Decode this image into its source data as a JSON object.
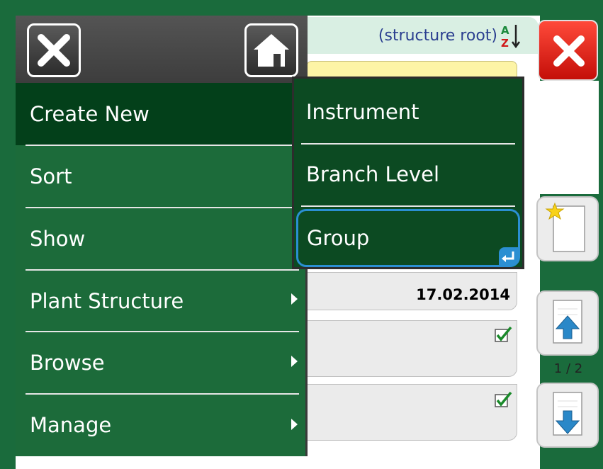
{
  "header": {
    "title": "(structure root)",
    "sort_icon": "sort-az-icon",
    "close_icon": "close-icon",
    "home_icon": "home-icon"
  },
  "menu": {
    "items": [
      {
        "label": "Create New",
        "selected": true,
        "has_submenu": false
      },
      {
        "label": "Sort",
        "has_submenu": false
      },
      {
        "label": "Show",
        "has_submenu": false
      },
      {
        "label": "Plant Structure",
        "has_submenu": true
      },
      {
        "label": "Browse",
        "has_submenu": true
      },
      {
        "label": "Manage",
        "has_submenu": true
      }
    ]
  },
  "submenu": {
    "items": [
      {
        "label": "Instrument"
      },
      {
        "label": "Branch Level"
      },
      {
        "label": "Group",
        "focused": true
      }
    ]
  },
  "record": {
    "date": "17.02.2014"
  },
  "pager": {
    "text": "1 / 2"
  },
  "colors": {
    "menu_bg": "#1c6b3a",
    "menu_selected": "#03401a",
    "focus_border": "#2b8fd2",
    "close_red": "#e0201a",
    "title_text": "#2b3f90"
  }
}
